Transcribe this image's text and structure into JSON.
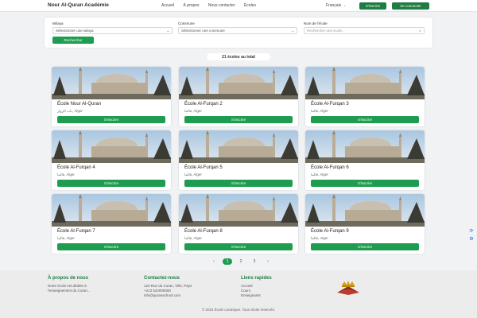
{
  "header": {
    "brand": "Nour Al-Quran Académie",
    "nav": [
      "Accueil",
      "À propos",
      "Nous contacter",
      "Écoles"
    ],
    "language": "Français",
    "signup": "S'inscrire",
    "login": "Se connecter"
  },
  "search": {
    "wilaya_label": "Wilaya",
    "wilaya_value": "Sélectionner une wilaya",
    "commune_label": "Commune",
    "commune_value": "Sélectionner une commune",
    "name_label": "Nom de l'école",
    "name_placeholder": "Rechercher une école...",
    "button": "Rechercher"
  },
  "total": "21 écoles au total",
  "cards": [
    {
      "name": "École Nour Al-Quran",
      "location": "باب الزوار, Alger",
      "button": "S'inscrire"
    },
    {
      "name": "École Al-Furqan 2",
      "location": "قالما, Alger",
      "button": "S'inscrire"
    },
    {
      "name": "École Al-Furqan 3",
      "location": "قالما, Alger",
      "button": "S'inscrire"
    },
    {
      "name": "École Al-Furqan 4",
      "location": "قالما, Alger",
      "button": "S'inscrire"
    },
    {
      "name": "École Al-Furqan 5",
      "location": "قالما, Alger",
      "button": "S'inscrire"
    },
    {
      "name": "École Al-Furqan 6",
      "location": "قالما, Alger",
      "button": "S'inscrire"
    },
    {
      "name": "École Al-Furqan 7",
      "location": "قالما, Alger",
      "button": "S'inscrire"
    },
    {
      "name": "École Al-Furqan 8",
      "location": "قالما, Alger",
      "button": "S'inscrire"
    },
    {
      "name": "École Al-Furqan 9",
      "location": "قالما, Alger",
      "button": "S'inscrire"
    }
  ],
  "pagination": {
    "prev": "‹",
    "pages": [
      "1",
      "2",
      "3"
    ],
    "next": "›",
    "current": "1"
  },
  "footer": {
    "about_title": "À propos de nous",
    "about_lines": [
      "Notre école est dédiée à",
      "l'enseignement du Coran..."
    ],
    "contact_title": "Contactez-nous",
    "contact_lines": [
      "123 Rue du Coran, Ville, Pays",
      "+213 522000000",
      "info@quranschool.com"
    ],
    "links_title": "Liens rapides",
    "links": [
      "Accueil",
      "Cours",
      "Enseignants"
    ],
    "copyright": "© 2024 École coranique. Tous droits réservés."
  },
  "icons": {
    "search": "search-icon",
    "chevron": "chevron-down-icon",
    "translate": "translate-icon",
    "gear": "gear-icon"
  },
  "colors": {
    "primary": "#1e9c4f",
    "dark_primary": "#1e7d43",
    "accent_side": "#2563eb"
  }
}
